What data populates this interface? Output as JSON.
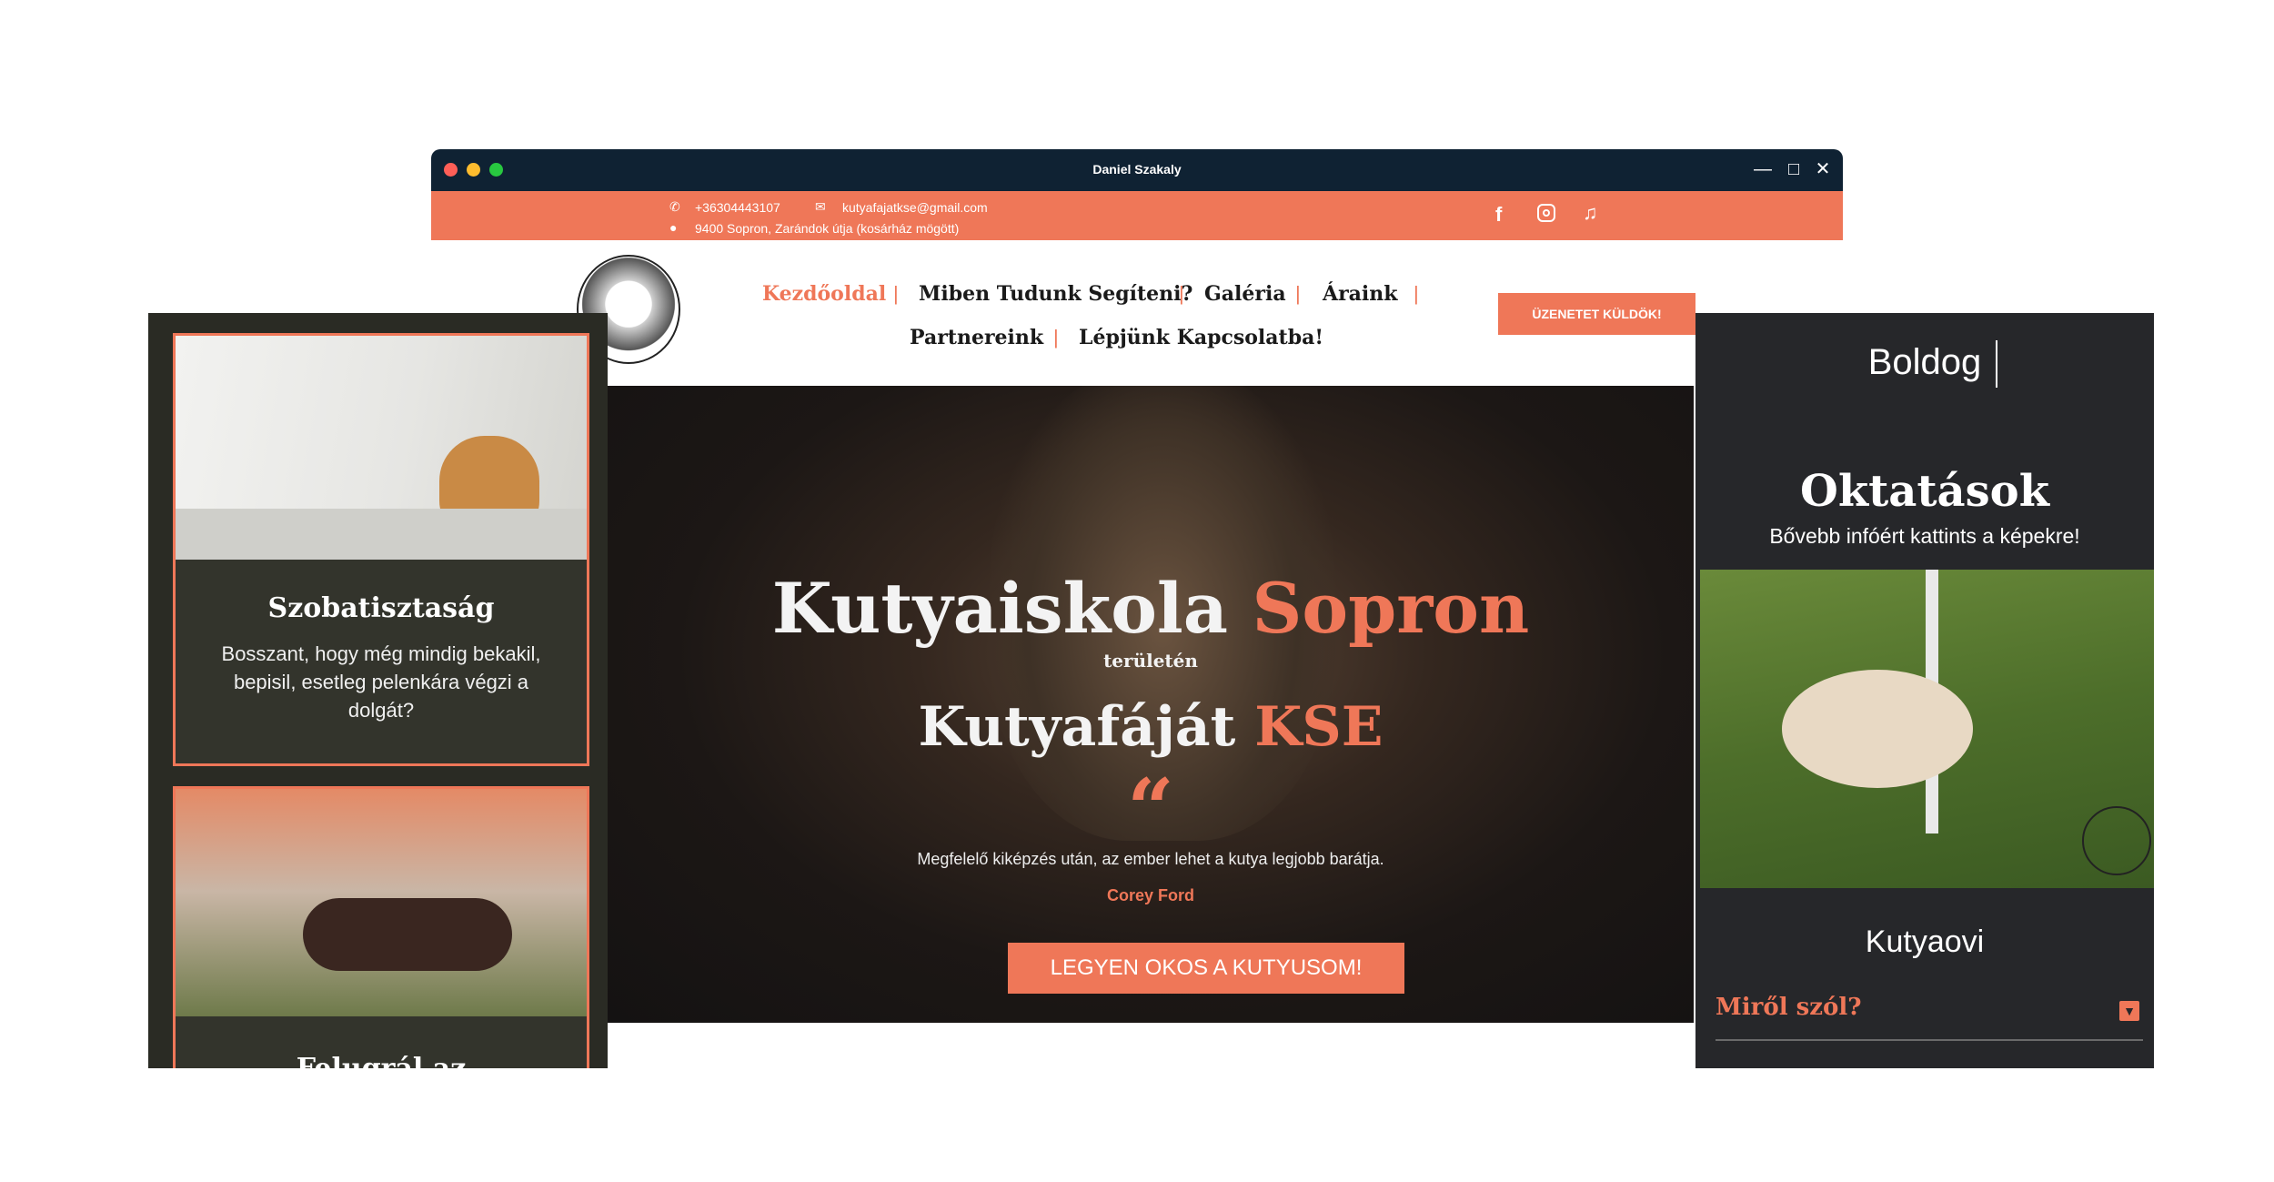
{
  "window": {
    "title": "Daniel Szakaly"
  },
  "topbar": {
    "phone": "+36304443107",
    "email": "kutyafajatkse@gmail.com",
    "address": "9400 Sopron, Zarándok útja (kosárház mögött)"
  },
  "nav": {
    "items": [
      {
        "label": "Kezdőoldal",
        "active": true
      },
      {
        "label": "Miben Tudunk Segíteni?"
      },
      {
        "label": "Galéria"
      },
      {
        "label": "Áraink"
      },
      {
        "label": "Partnereink"
      },
      {
        "label": "Lépjünk Kapcsolatba!"
      }
    ],
    "cta": "ÜZENETET KÜLDÖK!"
  },
  "hero": {
    "title_part1": "Kutyaiskola",
    "title_part2": "Sopron",
    "subtitle": "területén",
    "title2_part1": "Kutyafáját",
    "title2_part2": "KSE",
    "quote_mark": "“",
    "quote": "Megfelelő kiképzés után, az ember lehet a kutya legjobb barátja.",
    "quote_author": "Corey Ford",
    "button": "LEGYEN OKOS A KUTYUSOM!"
  },
  "left_phone": {
    "cards": [
      {
        "title": "Szobatisztaság",
        "text": "Bosszant, hogy még mindig bekakil, bepisil, esetleg pelenkára végzi a dolgát?"
      },
      {
        "title": "Felugrál az"
      }
    ]
  },
  "right_phone": {
    "typing": "Boldog",
    "title": "Oktatások",
    "subtitle": "Bővebb infóért kattints a képekre!",
    "card_title": "Kutyaovi",
    "accordion": "Miről szól?"
  },
  "colors": {
    "accent": "#ef7758",
    "dark": "#0f2233"
  }
}
